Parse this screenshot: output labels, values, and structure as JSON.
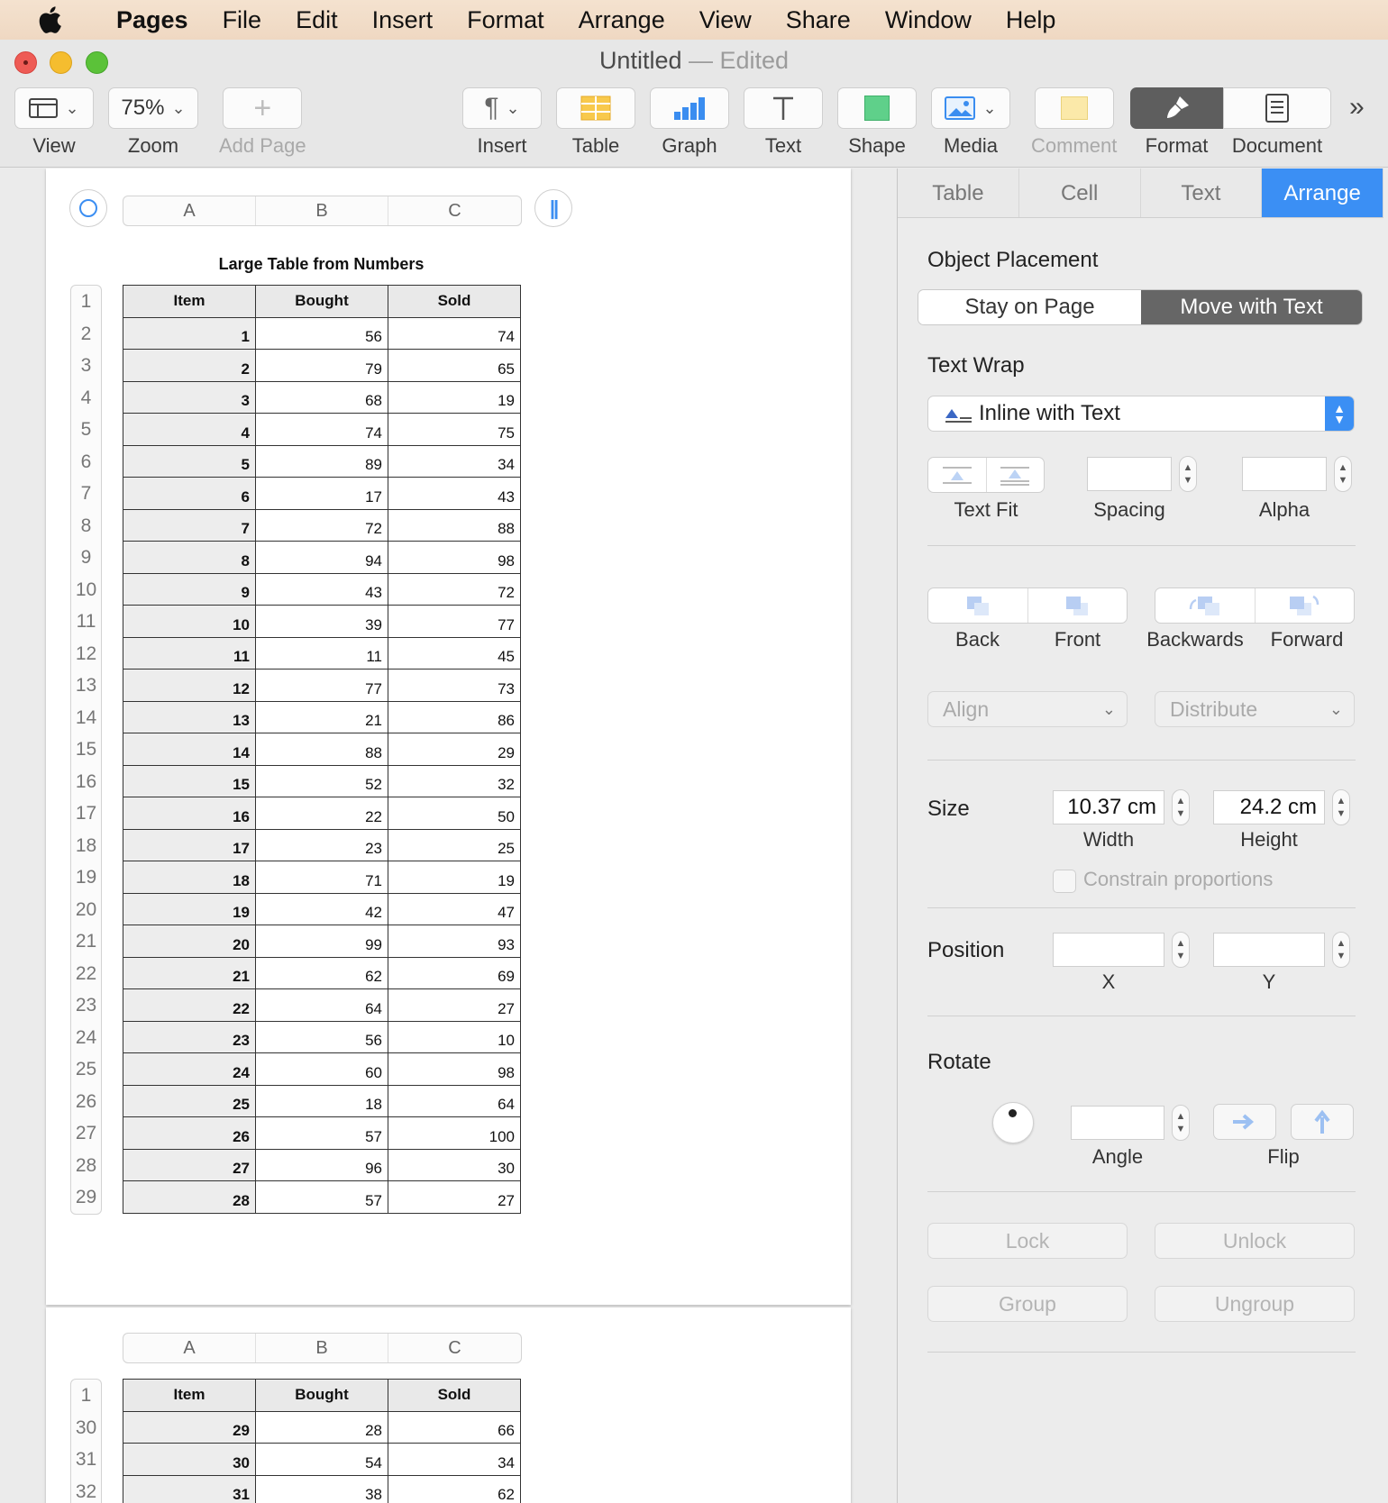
{
  "menubar": {
    "app_name": "Pages",
    "items": [
      "File",
      "Edit",
      "Insert",
      "Format",
      "Arrange",
      "View",
      "Share",
      "Window",
      "Help"
    ]
  },
  "window": {
    "title": "Untitled",
    "separator": " — ",
    "status": "Edited"
  },
  "toolbar": {
    "view": "View",
    "zoom_value": "75%",
    "zoom": "Zoom",
    "add_page": "Add Page",
    "insert": "Insert",
    "table": "Table",
    "graph": "Graph",
    "text": "Text",
    "shape": "Shape",
    "media": "Media",
    "comment": "Comment",
    "format": "Format",
    "document": "Document",
    "overflow": "»"
  },
  "document": {
    "table_title": "Large Table from Numbers",
    "column_letters": [
      "A",
      "B",
      "C"
    ],
    "headers": [
      "Item",
      "Bought",
      "Sold"
    ],
    "rows_page1": [
      [
        "1",
        "56",
        "74"
      ],
      [
        "2",
        "79",
        "65"
      ],
      [
        "3",
        "68",
        "19"
      ],
      [
        "4",
        "74",
        "75"
      ],
      [
        "5",
        "89",
        "34"
      ],
      [
        "6",
        "17",
        "43"
      ],
      [
        "7",
        "72",
        "88"
      ],
      [
        "8",
        "94",
        "98"
      ],
      [
        "9",
        "43",
        "72"
      ],
      [
        "10",
        "39",
        "77"
      ],
      [
        "11",
        "11",
        "45"
      ],
      [
        "12",
        "77",
        "73"
      ],
      [
        "13",
        "21",
        "86"
      ],
      [
        "14",
        "88",
        "29"
      ],
      [
        "15",
        "52",
        "32"
      ],
      [
        "16",
        "22",
        "50"
      ],
      [
        "17",
        "23",
        "25"
      ],
      [
        "18",
        "71",
        "19"
      ],
      [
        "19",
        "42",
        "47"
      ],
      [
        "20",
        "99",
        "93"
      ],
      [
        "21",
        "62",
        "69"
      ],
      [
        "22",
        "64",
        "27"
      ],
      [
        "23",
        "56",
        "10"
      ],
      [
        "24",
        "60",
        "98"
      ],
      [
        "25",
        "18",
        "64"
      ],
      [
        "26",
        "57",
        "100"
      ],
      [
        "27",
        "96",
        "30"
      ],
      [
        "28",
        "57",
        "27"
      ]
    ],
    "row_numbers_page1": [
      "1",
      "2",
      "3",
      "4",
      "5",
      "6",
      "7",
      "8",
      "9",
      "10",
      "11",
      "12",
      "13",
      "14",
      "15",
      "16",
      "17",
      "18",
      "19",
      "20",
      "21",
      "22",
      "23",
      "24",
      "25",
      "26",
      "27",
      "28",
      "29"
    ],
    "rows_page2": [
      [
        "29",
        "28",
        "66"
      ],
      [
        "30",
        "54",
        "34"
      ],
      [
        "31",
        "38",
        "62"
      ]
    ],
    "row_numbers_page2": [
      "1",
      "30",
      "31",
      "32"
    ]
  },
  "inspector": {
    "tabs": [
      "Table",
      "Cell",
      "Text",
      "Arrange"
    ],
    "active_tab": "Arrange",
    "object_placement": "Object Placement",
    "stay_on_page": "Stay on Page",
    "move_with_text": "Move with Text",
    "text_wrap": "Text Wrap",
    "text_wrap_value": "Inline with Text",
    "text_fit": "Text Fit",
    "spacing": "Spacing",
    "alpha": "Alpha",
    "back": "Back",
    "front": "Front",
    "backwards": "Backwards",
    "forward": "Forward",
    "align": "Align",
    "distribute": "Distribute",
    "size": "Size",
    "width_value": "10.37 cm",
    "width": "Width",
    "height_value": "24.2 cm",
    "height": "Height",
    "constrain": "Constrain proportions",
    "position": "Position",
    "x": "X",
    "y": "Y",
    "rotate": "Rotate",
    "angle": "Angle",
    "flip": "Flip",
    "lock": "Lock",
    "unlock": "Unlock",
    "group": "Group",
    "ungroup": "Ungroup"
  },
  "colors": {
    "accent": "#3b8ff4",
    "close": "#ee5b55",
    "minimize": "#f5bd2f",
    "zoom": "#5bc239"
  }
}
